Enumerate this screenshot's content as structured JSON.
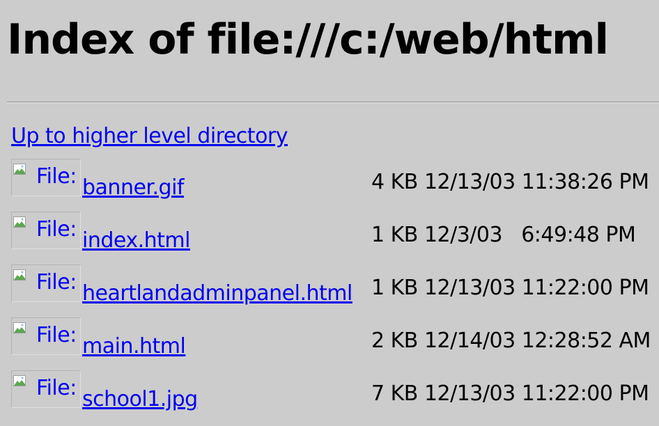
{
  "page": {
    "title": "Index of file:///c:/web/html",
    "up_link": "Up to higher level directory",
    "icon_alt": "File:"
  },
  "files": [
    {
      "name": "banner.gif",
      "size": "4 KB",
      "date": "12/13/03",
      "time": "11:38:26 PM"
    },
    {
      "name": "index.html",
      "size": "1 KB",
      "date": "12/3/03",
      "time": "6:49:48 PM"
    },
    {
      "name": "heartlandadminpanel.html",
      "size": "1 KB",
      "date": "12/13/03",
      "time": "11:22:00 PM"
    },
    {
      "name": "main.html",
      "size": "2 KB",
      "date": "12/14/03",
      "time": "12:28:52 AM"
    },
    {
      "name": "school1.jpg",
      "size": "7 KB",
      "date": "12/13/03",
      "time": "11:22:00 PM"
    }
  ],
  "colors": {
    "background": "#cccccc",
    "link": "#0000ee",
    "text": "#000000"
  },
  "icons": {
    "file_icon": "broken-image-icon"
  }
}
